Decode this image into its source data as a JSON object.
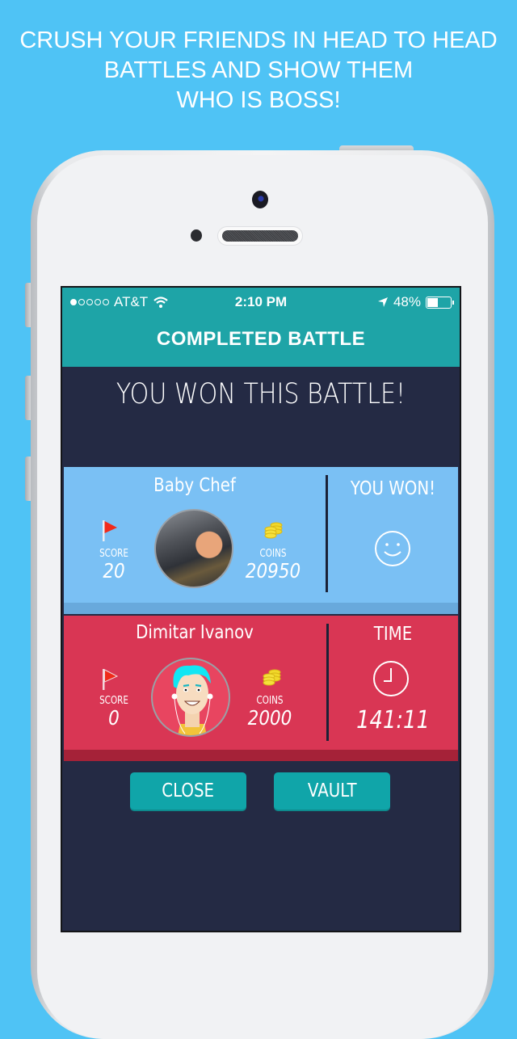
{
  "promo": {
    "lines": [
      "CRUSH YOUR FRIENDS IN HEAD TO HEAD",
      "BATTLES AND SHOW THEM",
      "WHO IS BOSS!"
    ]
  },
  "status_bar": {
    "carrier": "AT&T",
    "signal_bars_filled": 1,
    "signal_bars_total": 5,
    "time": "2:10 PM",
    "battery_percent_label": "48%",
    "battery_level": 0.48
  },
  "header": {
    "title": "COMPLETED BATTLE"
  },
  "result_banner": "YOU WON THIS BATTLE!",
  "colors": {
    "background": "#4fc3f5",
    "header": "#1ea4a7",
    "screen_bg": "#242a44",
    "player_card": "#7ac0f4",
    "opponent_card": "#d93654",
    "button": "#10a5a9"
  },
  "player": {
    "name": "Baby Chef",
    "score_label": "SCORE",
    "score": "20",
    "coins_label": "COINS",
    "coins": "20950",
    "outcome_label": "YOU WON!",
    "outcome_icon": "smiley-icon"
  },
  "opponent": {
    "name": "Dimitar Ivanov",
    "score_label": "SCORE",
    "score": "0",
    "coins_label": "COINS",
    "coins": "2000",
    "time_label": "TIME",
    "time_icon": "clock-icon",
    "time_value": "141:11"
  },
  "buttons": {
    "close": "CLOSE",
    "vault": "VAULT"
  }
}
